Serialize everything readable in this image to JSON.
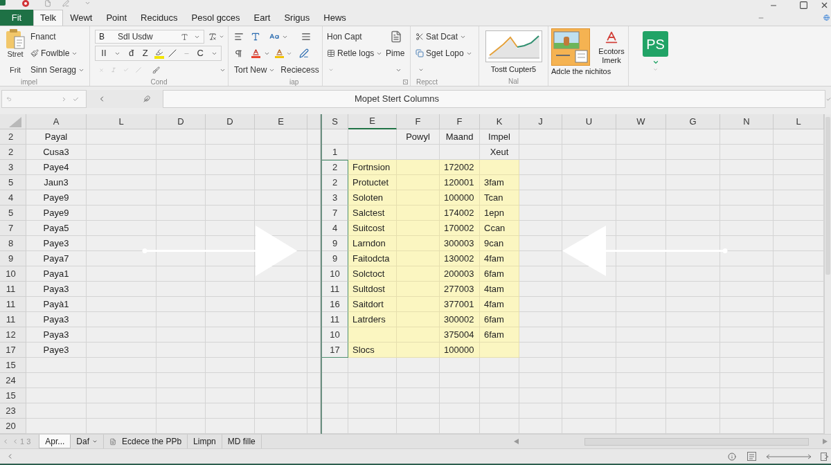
{
  "menu_tabs": [
    {
      "label": "Fit",
      "kind": "file",
      "selected": false
    },
    {
      "label": "Telk",
      "kind": "tab",
      "selected": true
    },
    {
      "label": "Wewt",
      "kind": "tab",
      "selected": false
    },
    {
      "label": "Point",
      "kind": "tab",
      "selected": false
    },
    {
      "label": "Reciducs",
      "kind": "tab",
      "selected": false
    },
    {
      "label": "Pesol gcces",
      "kind": "tab",
      "selected": false
    },
    {
      "label": "Eart",
      "kind": "tab",
      "selected": false
    },
    {
      "label": "Srigus",
      "kind": "tab",
      "selected": false
    },
    {
      "label": "Hews",
      "kind": "tab",
      "selected": false
    }
  ],
  "ribbon": {
    "groups": [
      {
        "kind": "paste",
        "large_button": "Stret",
        "side_text": "Frit",
        "commands": [
          {
            "label": "Fnanct",
            "kind": "plain",
            "dropdown": false
          },
          {
            "label": "Fowlble",
            "kind": "with_icon",
            "dropdown": true
          },
          {
            "label": "Sinn Seragg",
            "kind": "plain",
            "dropdown": true
          }
        ],
        "label": "impel"
      },
      {
        "kind": "font",
        "font_box": {
          "letter": "B",
          "font": "Sdl Usdw"
        },
        "format_items": [
          {
            "kind": "text",
            "label": "II"
          },
          {
            "kind": "caret"
          },
          {
            "kind": "text",
            "label": "đ"
          },
          {
            "kind": "text",
            "label": "Z"
          },
          {
            "kind": "highlight"
          },
          {
            "kind": "slash"
          },
          {
            "kind": "dash"
          },
          {
            "kind": "text",
            "label": "C"
          },
          {
            "kind": "caret"
          }
        ],
        "label": "Cond"
      },
      {
        "kind": "paragraph",
        "commands": [
          {
            "label": "Tort New",
            "kind": "plain",
            "dropdown": true
          },
          {
            "label": "Reciecess",
            "kind": "plain",
            "dropdown": false
          }
        ],
        "label": "iap"
      },
      {
        "kind": "list",
        "commands": [
          {
            "label": "Hon Capt",
            "kind": "plain",
            "dropdown": false
          },
          {
            "label": "Retle logs",
            "kind": "with_icon",
            "dropdown": true
          }
        ],
        "side_button": "Pime"
      },
      {
        "kind": "list_icons",
        "commands": [
          {
            "label": "Sat Dcat",
            "kind": "with_icon",
            "dropdown": true
          },
          {
            "label": "Sget Lopo",
            "kind": "with_icon",
            "dropdown": true
          }
        ],
        "label": "Repcct"
      },
      {
        "kind": "chart",
        "button": "Tostt Cupter5",
        "label": "Nal"
      },
      {
        "kind": "picture",
        "selected": true,
        "side_text": "Ecotors Imerk",
        "caption": "Adcle the nichitos"
      },
      {
        "kind": "tile",
        "tile": "PS"
      }
    ]
  },
  "formula_bar": {
    "value": "Mopet Stert Columns"
  },
  "left_pane": {
    "columns": [
      {
        "label": "A",
        "selected": false
      },
      {
        "label": "L",
        "selected": false
      },
      {
        "label": "D",
        "selected": false
      },
      {
        "label": "D",
        "selected": false
      },
      {
        "label": "E",
        "selected": false
      }
    ],
    "rows": [
      {
        "number": "2",
        "value": "Payal"
      },
      {
        "number": "2",
        "value": "Cusa3"
      },
      {
        "number": "3",
        "value": "Paye4"
      },
      {
        "number": "5",
        "value": "Jaun3"
      },
      {
        "number": "4",
        "value": "Paye9"
      },
      {
        "number": "5",
        "value": "Paye9"
      },
      {
        "number": "7",
        "value": "Paya5"
      },
      {
        "number": "8",
        "value": "Paye3"
      },
      {
        "number": "9",
        "value": "Paya7"
      },
      {
        "number": "10",
        "value": "Paya1"
      },
      {
        "number": "11",
        "value": "Paya3"
      },
      {
        "number": "11",
        "value": "Payà1"
      },
      {
        "number": "11",
        "value": "Paya3"
      },
      {
        "number": "12",
        "value": "Paya3"
      },
      {
        "number": "17",
        "value": "Paye3"
      },
      {
        "number": "15"
      },
      {
        "number": "24"
      },
      {
        "number": "15"
      },
      {
        "number": "23"
      },
      {
        "number": "20"
      }
    ]
  },
  "right_pane": {
    "columns": [
      {
        "label": "S",
        "selected": false
      },
      {
        "label": "E",
        "selected": true
      },
      {
        "label": "F",
        "selected": false
      },
      {
        "label": "F",
        "selected": false
      },
      {
        "label": "K",
        "selected": false
      },
      {
        "label": "J",
        "selected": false
      },
      {
        "label": "U",
        "selected": false
      },
      {
        "label": "W",
        "selected": false
      },
      {
        "label": "G",
        "selected": false
      },
      {
        "label": "N",
        "selected": false
      },
      {
        "label": "L",
        "selected": false
      }
    ],
    "rows": [
      {
        "kind": "header",
        "highlighted": false,
        "col_F1": "Powyl",
        "col_F2": "Maand",
        "col_K": "Impel"
      },
      {
        "kind": "header",
        "highlighted": false,
        "number": "1",
        "col_K": "Xeut"
      },
      {
        "kind": "data",
        "highlighted": true,
        "number": "2",
        "col_E": "Fortnsion",
        "col_F2": "172002"
      },
      {
        "kind": "data",
        "highlighted": true,
        "number": "2",
        "col_E": "Protuctet",
        "col_F2": "120001",
        "col_K": "3fam"
      },
      {
        "kind": "data",
        "highlighted": true,
        "number": "3",
        "col_E": "Soloten",
        "col_F2": "100000",
        "col_K": "Tcan"
      },
      {
        "kind": "data",
        "highlighted": true,
        "number": "7",
        "col_E": "Salctest",
        "col_F2": "174002",
        "col_K": "1epn"
      },
      {
        "kind": "data",
        "highlighted": true,
        "number": "4",
        "col_E": "Suitcost",
        "col_F2": "170002",
        "col_K": "Ccan"
      },
      {
        "kind": "data",
        "highlighted": true,
        "number": "9",
        "col_E": "Larndon",
        "col_F2": "300003",
        "col_K": "9can"
      },
      {
        "kind": "data",
        "highlighted": true,
        "number": "9",
        "col_E": "Faitodcta",
        "col_F2": "130002",
        "col_K": "4fam"
      },
      {
        "kind": "data",
        "highlighted": true,
        "number": "10",
        "col_E": "Solctoct",
        "col_F2": "200003",
        "col_K": "6fam"
      },
      {
        "kind": "data",
        "highlighted": true,
        "number": "11",
        "col_E": "Sultdost",
        "col_F2": "277003",
        "col_K": "4tam"
      },
      {
        "kind": "data",
        "highlighted": true,
        "number": "16",
        "col_E": "Saitdort",
        "col_F2": "377001",
        "col_K": "4fam"
      },
      {
        "kind": "data",
        "highlighted": true,
        "number": "11",
        "col_E": "Latrders",
        "col_F2": "300002",
        "col_K": "6fam"
      },
      {
        "kind": "data",
        "highlighted": true,
        "number": "10",
        "col_F2": "375004",
        "col_K": "6fam"
      },
      {
        "kind": "data",
        "highlighted": true,
        "number": "17",
        "col_E": "Slocs",
        "col_F2": "100000"
      }
    ]
  },
  "sheet_bar": {
    "nav": "1 3",
    "tabs": [
      {
        "label": "Apr...",
        "kind": "sheet",
        "selected": true
      },
      {
        "label": "Daf",
        "kind": "dropdown",
        "selected": false
      },
      {
        "label": "Ecdece the PPb",
        "kind": "document",
        "selected": false
      },
      {
        "label": "Limpn",
        "kind": "sheet",
        "selected": false
      },
      {
        "label": "MD fille",
        "kind": "sheet",
        "selected": false
      }
    ]
  }
}
